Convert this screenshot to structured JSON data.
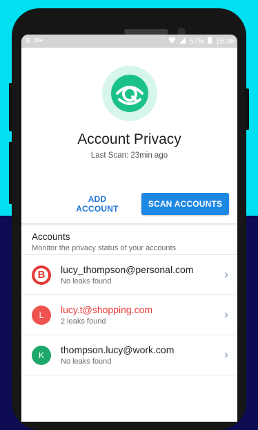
{
  "status_bar": {
    "time": "16:36",
    "battery": "57%",
    "icons": [
      "b-icon",
      "key-icon",
      "wifi-icon",
      "signal-icon",
      "battery-icon"
    ]
  },
  "header": {
    "title": "Account Privacy",
    "last_scan": "Last Scan: 23min ago",
    "logo_icon": "eye-shield-icon",
    "logo_color": "#1bc18b"
  },
  "actions": {
    "add_label": "ADD ACCOUNT",
    "scan_label": "SCAN ACCOUNTS",
    "accent": "#1e88e5"
  },
  "accounts": {
    "title": "Accounts",
    "subtitle": "Monitor the privacy status of your accounts",
    "items": [
      {
        "avatar": "B",
        "email": "lucy_thompson@personal.com",
        "status": "No leaks found",
        "color": "#e53935"
      },
      {
        "avatar": "L",
        "email": "lucy.t@shopping.com",
        "status": "2 leaks found",
        "color": "#ef5350"
      },
      {
        "avatar": "K",
        "email": "thompson.lucy@work.com",
        "status": "No leaks found",
        "color": "#1ea86a"
      }
    ]
  }
}
